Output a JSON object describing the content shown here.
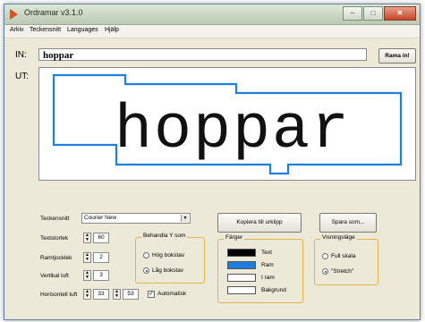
{
  "window": {
    "title": "Ordramar v3.1.0"
  },
  "menu": [
    "Arkiv",
    "Teckensnitt",
    "Languages",
    "Hjälp"
  ],
  "input": {
    "label": "IN:",
    "value": "hoppar"
  },
  "output_label": "UT:",
  "rama_button": "Rama in!",
  "preview_word": "hoppar",
  "settings": {
    "font_label": "Teckensnitt",
    "font_value": "Courier New",
    "size_label": "Textstorlek",
    "size_value": "60",
    "border_label": "Ramtjocklek",
    "border_value": "2",
    "vertical_label": "Vertikal luft",
    "vertical_value": "3",
    "horizontal_label": "Horisontell luft",
    "horizontal_value1": "33",
    "horizontal_value2": "53",
    "auto_label": "Automatisk"
  },
  "treat_group": {
    "title": "Behandla Y som",
    "option_high": "Hög bokstav",
    "option_low": "Låg bokstav",
    "selected": "Låg bokstav"
  },
  "copy_button": "Kopiera till urklipp",
  "save_button": "Spara som...",
  "colors_group": {
    "title": "Färger",
    "items": [
      {
        "label": "Text",
        "color": "#000000"
      },
      {
        "label": "Ram",
        "color": "#1f7fe0"
      },
      {
        "label": "I ram",
        "color": "#ffffff"
      },
      {
        "label": "Bakgrund",
        "color": "#ffffff"
      }
    ]
  },
  "view_group": {
    "title": "Visningsläge",
    "option_full": "Full skala",
    "option_stretch": "\"Stretch\"",
    "selected": "\"Stretch\""
  }
}
